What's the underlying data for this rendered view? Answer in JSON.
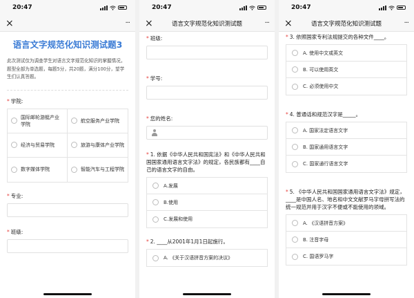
{
  "status": {
    "time": "20:47"
  },
  "screen1": {
    "nav_title": "",
    "form_title": "语言文字规范化知识测试题3",
    "intro": "此次测试仅为调查学生对语言文字规范化知识的掌握情况，题型全部为单选题，每题5分，共20题，满分100分，望学生们认真答题。",
    "q_college": {
      "required": "*",
      "label": "学院:"
    },
    "colleges": [
      "国际邮轮游艇产业学院",
      "航空服务产业学院",
      "经济与贸易学院",
      "旅游与康体产业学院",
      "数字媒体学院",
      "智能汽车与工程学院"
    ],
    "q_major": {
      "required": "*",
      "label": "专业:"
    },
    "q_class": {
      "required": "*",
      "label": "班级:"
    }
  },
  "screen2": {
    "nav_title": "语言文字规范化知识测试题",
    "q_class": {
      "required": "*",
      "label": "班级:"
    },
    "q_student_id": {
      "required": "*",
      "label": "学号:"
    },
    "q_name": {
      "required": "*",
      "label": "您的姓名:"
    },
    "q1": {
      "required": "*",
      "label": "1. 依据《中华人民共和国宪法》和《中华人民共和国国家通用语言文字法》的规定，各民族都有____自己的语言文字的自由。",
      "options": [
        "A.发展",
        "B.使用",
        "C.发展和使用"
      ]
    },
    "q2": {
      "required": "*",
      "label": "2. ____从2001年1月1日起施行。",
      "options": [
        "A. 《关于汉语拼音方案的决议》"
      ]
    }
  },
  "screen3": {
    "nav_title": "语言文字规范化知识测试题",
    "q3": {
      "required": "*",
      "label": "3. 依照国家专利法规提交的各种文件____。",
      "options": [
        "A. 使用中文或英文",
        "B. 可以使用英文",
        "C. 必须使用中文"
      ]
    },
    "q4": {
      "required": "*",
      "label": "4. 普通话和规范汉字是_____。",
      "options": [
        "A. 国家法定语言文字",
        "B. 国家通用语言文字",
        "C. 国家通行语言文字"
      ]
    },
    "q5": {
      "required": "*",
      "label": "5. 《中华人民共和国国家通用语言文字法》规定，____是中国人名、地名和中文文献罗马字母拼写法的统一规范并用于汉字不便或不能使用的领域。",
      "options": [
        "A. 《汉语拼音方案》",
        "B. 注音字母",
        "C. 国语罗马字"
      ]
    }
  },
  "nav": {
    "close": "×",
    "more": "···"
  }
}
